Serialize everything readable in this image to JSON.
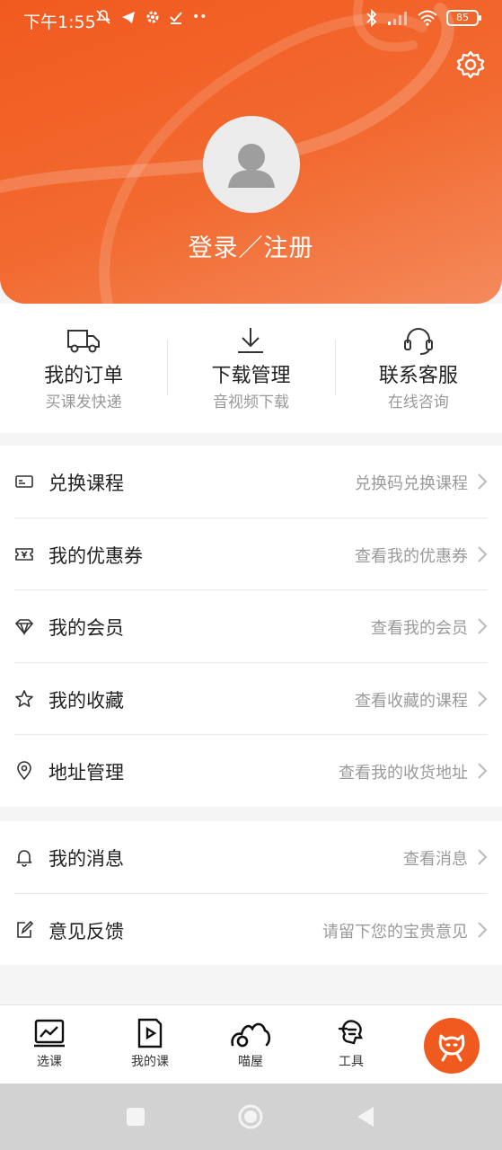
{
  "status_bar": {
    "time": "下午1:55",
    "battery": "85"
  },
  "header": {
    "login_label": "登录／注册"
  },
  "quick_actions": [
    {
      "title": "我的订单",
      "subtitle": "买课发快递",
      "icon": "truck-icon"
    },
    {
      "title": "下载管理",
      "subtitle": "音视频下载",
      "icon": "download-icon"
    },
    {
      "title": "联系客服",
      "subtitle": "在线咨询",
      "icon": "headset-icon"
    }
  ],
  "menu_group_1": [
    {
      "label": "兑换课程",
      "hint": "兑换码兑换课程",
      "icon": "card-icon"
    },
    {
      "label": "我的优惠券",
      "hint": "查看我的优惠券",
      "icon": "coupon-icon"
    },
    {
      "label": "我的会员",
      "hint": "查看我的会员",
      "icon": "diamond-icon"
    },
    {
      "label": "我的收藏",
      "hint": "查看收藏的课程",
      "icon": "star-icon"
    },
    {
      "label": "地址管理",
      "hint": "查看我的收货地址",
      "icon": "location-icon"
    }
  ],
  "menu_group_2": [
    {
      "label": "我的消息",
      "hint": "查看消息",
      "icon": "bell-icon"
    },
    {
      "label": "意见反馈",
      "hint": "请留下您的宝贵意见",
      "icon": "edit-icon"
    }
  ],
  "bottom_nav": [
    {
      "label": "选课",
      "icon": "chart-icon"
    },
    {
      "label": "我的课",
      "icon": "play-doc-icon"
    },
    {
      "label": "喵屋",
      "icon": "cat-icon"
    },
    {
      "label": "工具",
      "icon": "tool-icon"
    }
  ],
  "colors": {
    "brand": "#f15a1f",
    "text_primary": "#222222",
    "text_secondary": "#999999"
  }
}
